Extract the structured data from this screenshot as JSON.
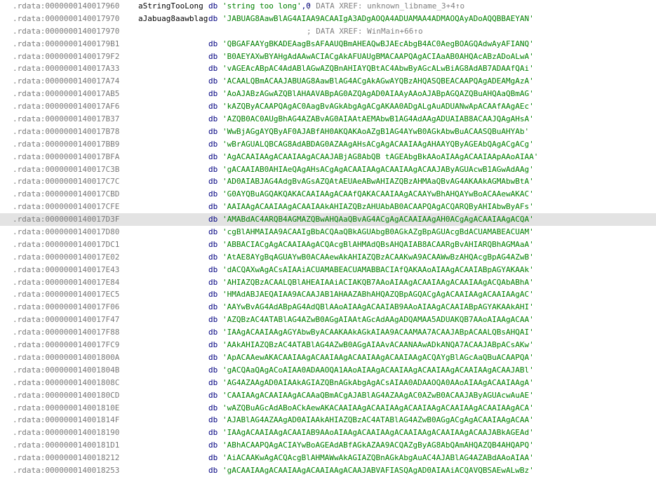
{
  "listing": {
    "rows": [
      {
        "addr": ".rdata:0000000140017960",
        "name": "aStringTooLong",
        "dir": "db",
        "str": "'string too long'",
        "num": ",0",
        "comment": "; DATA XREF: unknown_libname_3+4↑o",
        "highlight": false
      },
      {
        "addr": ".rdata:0000000140017970",
        "name": "aJabuag8aawblag",
        "dir": "db",
        "value": "'JABUAG8AawBlAG4AIAA9ACAAIgA3ADgAOQA4ADUAMAA4ADMAOQAyADoAQQBBAEYAN'",
        "highlight": false
      },
      {
        "addr": ".rdata:0000000140017970",
        "comment": "; DATA XREF: WinMain+66↑o",
        "highlight": false
      },
      {
        "addr": ".rdata:00000001400179B1",
        "dir": "db",
        "value": "'QBGAFAAYgBKADEAagBsAFAAUQBmAHEAQwBJAEcAbgB4AC0AegBOAGQAdwAyAFIANQ'",
        "highlight": false
      },
      {
        "addr": ".rdata:00000001400179F2",
        "dir": "db",
        "value": "'B0AEYAXwBYAHgAdAAwACIACgAkAFUAUgBMACAAPQAgACIAaAB0AHQAcABzADoALwA'",
        "highlight": false
      },
      {
        "addr": ".rdata:0000000140017A33",
        "dir": "db",
        "value": "'vAGEAcABpAC4AdABlAGwAZQBnAHIAYQBtAC4AbwByAGcALwBiAG8AdAB7ADAAfQAi'",
        "highlight": false
      },
      {
        "addr": ".rdata:0000000140017A74",
        "dir": "db",
        "value": "'ACAALQBmACAAJABUAG8AawBlAG4ACgAkAGwAYQBzAHQASQBEACAAPQAgADEAMgAzA'",
        "highlight": false
      },
      {
        "addr": ".rdata:0000000140017AB5",
        "dir": "db",
        "value": "'AoAJABzAGwAZQBlAHAAVABpAG0AZQAgAD0AIAAyAAoAJABpAGQAZQBuAHQAaQBmAG'",
        "highlight": false
      },
      {
        "addr": ".rdata:0000000140017AF6",
        "dir": "db",
        "value": "'kAZQByACAAPQAgAC0AagBvAGkAbgAgACgAKAA0ADgALgAuADUANwApACAAfAAgAEc'",
        "highlight": false
      },
      {
        "addr": ".rdata:0000000140017B37",
        "dir": "db",
        "value": "'AZQB0AC0AUgBhAG4AZABvAG0AIAAtAEMAbwB1AG4AdAAgADUAIAB8ACAAJQAgAHsA'",
        "highlight": false
      },
      {
        "addr": ".rdata:0000000140017B78",
        "dir": "db",
        "value": "'WwBjAGgAYQByAF0AJABfAH0AKQAKAoAZgB1AG4AYwB0AGkAbwBuACAASQBuAHYAb'",
        "highlight": false
      },
      {
        "addr": ".rdata:0000000140017BB9",
        "dir": "db",
        "value": "'wBrAGUALQBCAG8AdABDAG0AZAAgAHsACgAgACAAIAAgAHAAYQByAGEAbQAgACgACg'",
        "highlight": false
      },
      {
        "addr": ".rdata:0000000140017BFA",
        "dir": "db",
        "value": "'AgACAAIAAgACAAIAAgACAAJABjAG8AbQB tAGEAbgBkAAoAIAAgACAAIAApAAoAIAA'",
        "highlight": false
      },
      {
        "addr": ".rdata:0000000140017C3B",
        "dir": "db",
        "value": "'gACAAIAB0AHIAeQAgAHsACgAgACAAIAAgACAAIAAgACAAJAByAGUAcwB1AGwAdAAg'",
        "highlight": false
      },
      {
        "addr": ".rdata:0000000140017C7C",
        "dir": "db",
        "value": "'AD0AIABJAG4AdgBvAGsAZQAtAEUAeABwAHIAZQBzAHMAaQBvAG4AKAAkAGMAbwBtA'",
        "highlight": false
      },
      {
        "addr": ".rdata:0000000140017CBD",
        "dir": "db",
        "value": "'G0AYQBuAGQAKQAKACAAIAAgACAAfQAKACAAIAAgACAAYwBhAHQAYwBoACAAewAKAC'",
        "highlight": false
      },
      {
        "addr": ".rdata:0000000140017CFE",
        "dir": "db",
        "value": "'AAIAAgACAAIAAgACAAIAAkAHIAZQBzAHUAbAB0ACAAPQAgACQARQByAHIAbwByAFs'",
        "highlight": false
      },
      {
        "addr": ".rdata:0000000140017D3F",
        "dir": "db",
        "value": "'AMABdAC4ARQB4AGMAZQBwAHQAaQBvAG4ACgAgACAAIAAgAH0ACgAgACAAIAAgACQA'",
        "highlight": true
      },
      {
        "addr": ".rdata:0000000140017D80",
        "dir": "db",
        "value": "'cgBlAHMAIAA9ACAAIgBbACQAaQBkAGUAbgB0AGkAZgBpAGUAcgBdACUAMABEACUAM'",
        "highlight": false
      },
      {
        "addr": ".rdata:0000000140017DC1",
        "dir": "db",
        "value": "'ABBACIACgAgACAAIAAgACQAcgBlAHMAdQBsAHQAIAB8ACAARgBvAHIARQBhAGMAaA'",
        "highlight": false
      },
      {
        "addr": ".rdata:0000000140017E02",
        "dir": "db",
        "value": "'AtAE8AYgBqAGUAYwB0ACAAewAkAHIAZQBzACAAKwA9ACAAWwBzAHQAcgBpAG4AZwB'",
        "highlight": false
      },
      {
        "addr": ".rdata:0000000140017E43",
        "dir": "db",
        "value": "'dACQAXwAgACsAIAAiACUAMABEACUAMABBACIAfQAKAAoAIAAgACAAIABpAGYAKAAk'",
        "highlight": false
      },
      {
        "addr": ".rdata:0000000140017E84",
        "dir": "db",
        "value": "'AHIAZQBzACAALQBlAHEAIAAiACIAKQB7AAoAIAAgACAAIAAgACAAIAAgACQAbABhA'",
        "highlight": false
      },
      {
        "addr": ".rdata:0000000140017EC5",
        "dir": "db",
        "value": "'HMAdABJAEQAIAA9ACAAJAB1AHAAZABhAHQAZQBpAGQACgAgACAAIAAgACAAIAAgAC'",
        "highlight": false
      },
      {
        "addr": ".rdata:0000000140017F06",
        "dir": "db",
        "value": "'AAYwBvAG4AdABpAG4AdQBlAAoAIAAgACAAIAB9AAoAIAAgACAAIABpAGYAKAAkAHI'",
        "highlight": false
      },
      {
        "addr": ".rdata:0000000140017F47",
        "dir": "db",
        "value": "'AZQBzAC4ATABlAG4AZwB0AGgAIAAtAGcAdAAgADQAMAA5ADUAKQB7AAoAIAAgACAA'",
        "highlight": false
      },
      {
        "addr": ".rdata:0000000140017F88",
        "dir": "db",
        "value": "'IAAgACAAIAAgAGYAbwByACAAKAAkAGkAIAA9ACAAMAA7ACAAJABpACAALQBsAHQAI'",
        "highlight": false
      },
      {
        "addr": ".rdata:0000000140017FC9",
        "dir": "db",
        "value": "'AAkAHIAZQBzAC4ATABlAG4AZwB0AGgAIAAvACAANAAwADkANQA7ACAAJABpACsAKw'",
        "highlight": false
      },
      {
        "addr": ".rdata:000000014001800A",
        "dir": "db",
        "value": "'ApACAAewAKACAAIAAgACAAIAAgACAAIAAgACAAIAAgACQAYgBlAGcAaQBuACAAPQA'",
        "highlight": false
      },
      {
        "addr": ".rdata:000000014001804B",
        "dir": "db",
        "value": "'gACQAaQAgACoAIAA0ADAAOQA1AAoAIAAgACAAIAAgACAAIAAgACAAIAAgACAAJABl'",
        "highlight": false
      },
      {
        "addr": ".rdata:000000014001808C",
        "dir": "db",
        "value": "'AG4AZAAgAD0AIAAkAGIAZQBnAGkAbgAgACsAIAA0ADAAOQA0AAoAIAAgACAAIAAgA'",
        "highlight": false
      },
      {
        "addr": ".rdata:00000001400180CD",
        "dir": "db",
        "value": "'CAAIAAgACAAIAAgACAAaQBmACgAJABlAG4AZAAgAC0AZwB0ACAAJAByAGUAcwAuAE'",
        "highlight": false
      },
      {
        "addr": ".rdata:000000014001810E",
        "dir": "db",
        "value": "'wAZQBuAGcAdABoACkAewAKACAAIAAgACAAIAAgACAAIAAgACAAIAAgACAAIAAgACA'",
        "highlight": false
      },
      {
        "addr": ".rdata:000000014001814F",
        "dir": "db",
        "value": "'AJABlAG4AZAAgAD0AIAAkAHIAZQBzAC4ATABlAG4AZwB0AGgACgAgACAAIAAgACAA'",
        "highlight": false
      },
      {
        "addr": ".rdata:0000000140018190",
        "dir": "db",
        "value": "'IAAgACAAIAAgACAAIAB9AAoAIAAgACAAIAAgACAAIAAgACAAIAAgACAAJABkAGEAd'",
        "highlight": false
      },
      {
        "addr": ".rdata:00000001400181D1",
        "dir": "db",
        "value": "'ABhACAAPQAgACIAYwBoAGEAdABfAGkAZAA9ACQAZgByAG8AbQAmAHQAZQB4AHQAPQ'",
        "highlight": false
      },
      {
        "addr": ".rdata:0000000140018212",
        "dir": "db",
        "value": "'AiACAAKwAgACQAcgBlAHMAWwAkAGIAZQBnAGkAbgAuAC4AJABlAG4AZABdAAoAIAA'",
        "highlight": false
      },
      {
        "addr": ".rdata:0000000140018253",
        "dir": "db",
        "value": "'gACAAIAAgACAAIAAgACAAIAAgACAAJABVAFIASQAgAD0AIAAiACQAVQBSAEwALwBz'",
        "highlight": false
      }
    ]
  }
}
